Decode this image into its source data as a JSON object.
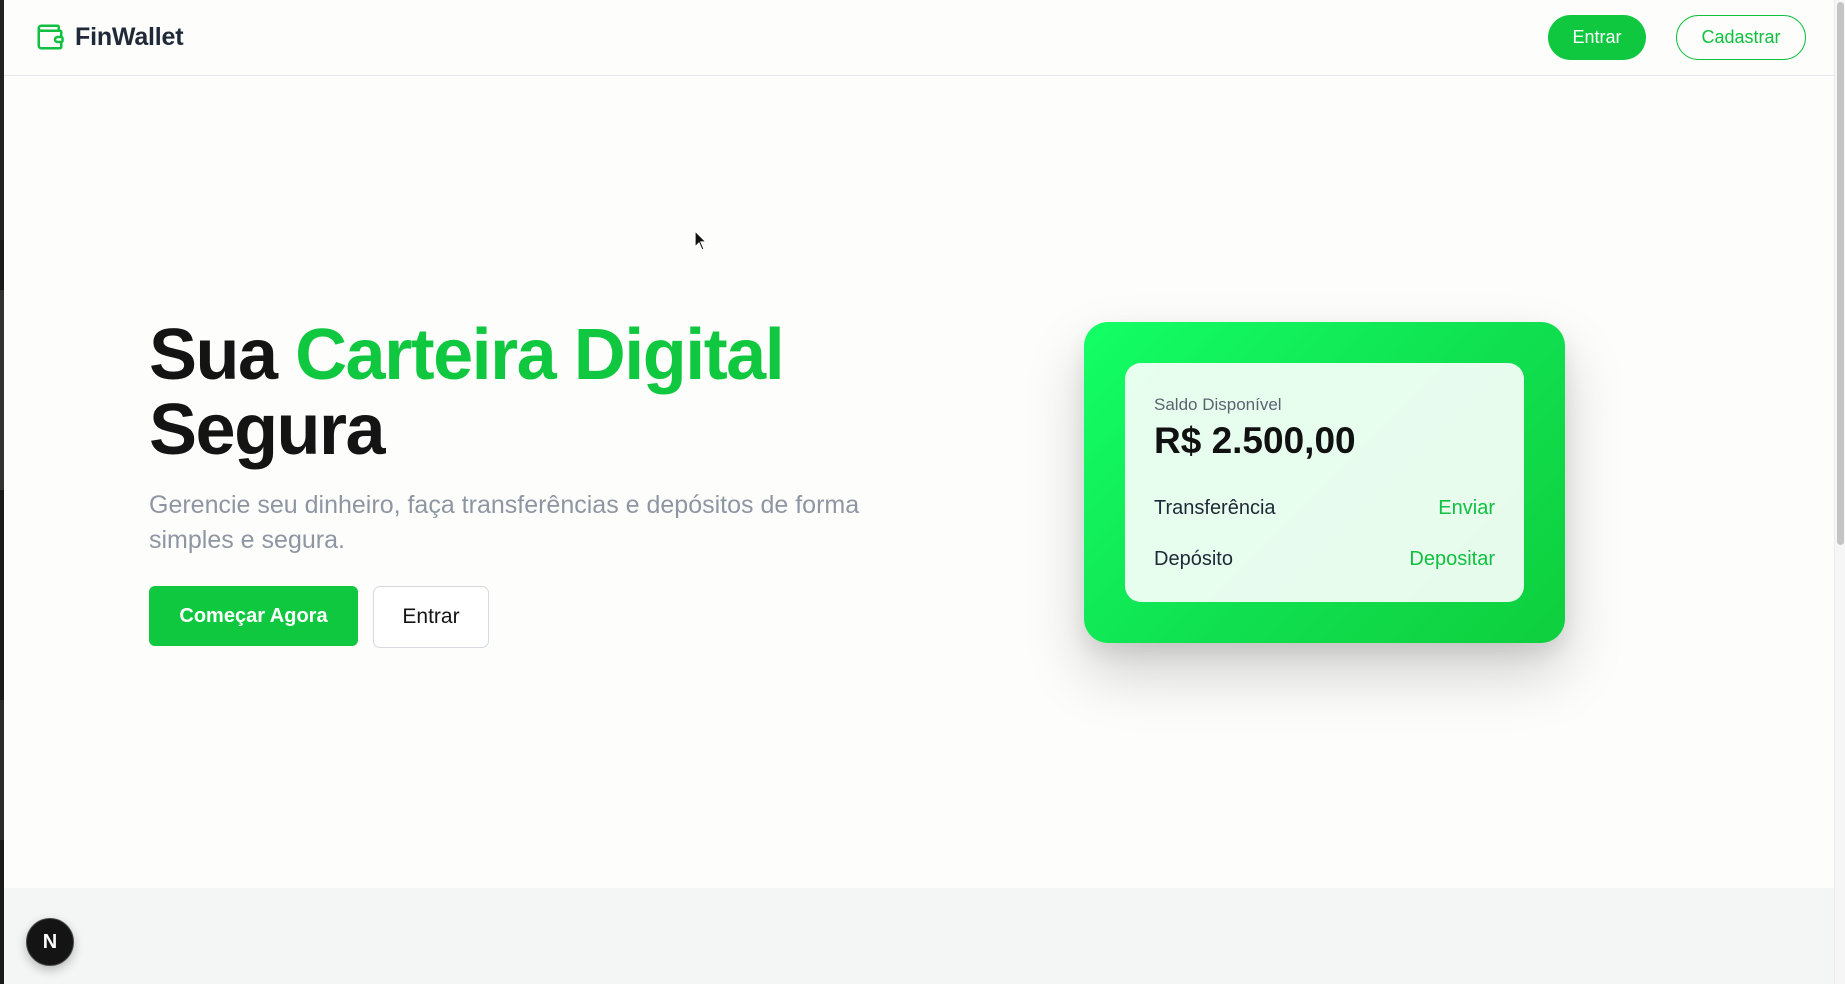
{
  "header": {
    "brand": "FinWallet",
    "login_label": "Entrar",
    "signup_label": "Cadastrar"
  },
  "hero": {
    "title_part1": "Sua ",
    "title_accent": "Carteira Digital",
    "title_part2": "Segura",
    "subtitle": "Gerencie seu dinheiro, faça transferências e depósitos de forma simples e segura.",
    "primary_cta": "Começar Agora",
    "secondary_cta": "Entrar"
  },
  "wallet_card": {
    "balance_label": "Saldo Disponível",
    "balance_value": "R$ 2.500,00",
    "transfer_label": "Transferência",
    "transfer_action": "Enviar",
    "deposit_label": "Depósito",
    "deposit_action": "Depositar"
  },
  "badge": {
    "letter": "N"
  },
  "colors": {
    "brand_green": "#0fc83f",
    "accent_text": "#10c740",
    "text_dark": "#141414",
    "subtitle_gray": "#8e96a3"
  },
  "icons": {
    "logo": "wallet-icon",
    "badge": "nextjs-logo-icon",
    "cursor": "mouse-pointer-icon"
  }
}
